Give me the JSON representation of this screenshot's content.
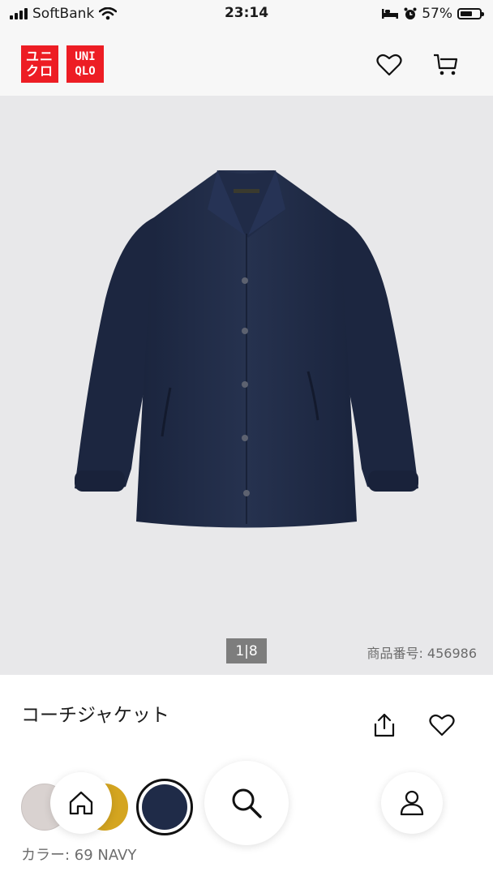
{
  "status_bar": {
    "carrier": "SoftBank",
    "time": "23:14",
    "battery": "57%"
  },
  "header": {
    "logo_jp_top": "ユニ",
    "logo_jp_bottom": "クロ",
    "logo_en_top": "UNI",
    "logo_en_bottom": "QLO",
    "icons": [
      "heart-icon",
      "cart-icon"
    ]
  },
  "gallery": {
    "pager": "1|8",
    "product_code": "商品番号: 456986"
  },
  "product": {
    "title": "コーチジャケット",
    "color_label": "カラー: 69 NAVY",
    "swatches": [
      {
        "name": "light-gray",
        "color": "#d9d2d0"
      },
      {
        "name": "mustard",
        "color": "#d4a520"
      },
      {
        "name": "navy",
        "color": "#1f2b48",
        "selected": true
      }
    ]
  },
  "nav": {
    "icons": [
      "home-icon",
      "search-icon",
      "account-icon"
    ]
  },
  "colors": {
    "brand_red": "#ed1d24",
    "hero_bg": "#e8e8ea",
    "jacket_navy": "#1f2b48"
  }
}
